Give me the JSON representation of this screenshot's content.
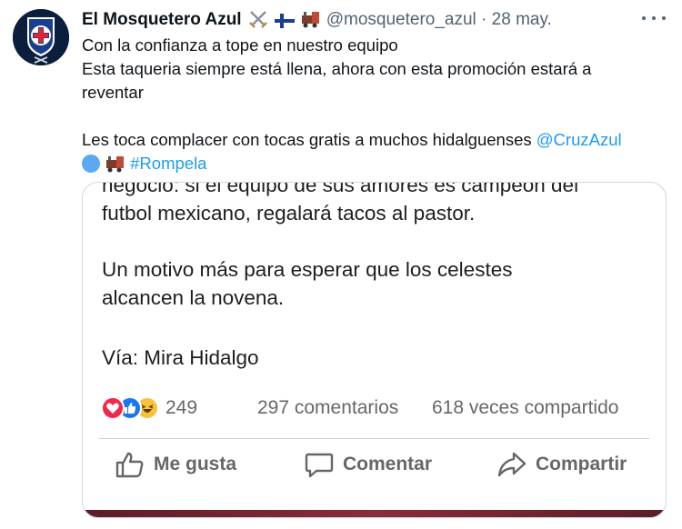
{
  "tweet": {
    "display_name": "El Mosquetero Azul",
    "name_emojis": [
      "crossed-swords-emoji",
      "finland-flag-emoji",
      "train-emoji"
    ],
    "handle": "@mosquetero_azul",
    "separator": "·",
    "date": "28 may.",
    "more_icon": "more-options-icon",
    "text_lines": [
      "Con la confianza a tope en nuestro equipo",
      "Esta taqueria siempre está llena, ahora con esta promoción estará a",
      "reventar",
      "Les toca complacer con tocas gratis a muchos hidalguenses "
    ],
    "mention": "@CruzAzul",
    "hashtag": "#Rompela",
    "tag_emojis": [
      "blue-circle-emoji",
      "train-emoji"
    ],
    "link_color": "#1d9bf0"
  },
  "avatar": {
    "badge_top_text": "DEPORTIVO",
    "badge_bottom_text": "CRUZ AZUL"
  },
  "embedded_post": {
    "clipped_line": "negocio: si el equipo de sus amores es campeón del",
    "lines": [
      "futbol mexicano, regalará tacos al pastor.",
      "Un motivo más para esperar que los celestes",
      "alcancen la novena.",
      "Vía: Mira Hidalgo"
    ],
    "reaction_icons": [
      "love-reaction-icon",
      "like-reaction-icon",
      "haha-reaction-icon"
    ],
    "reaction_count": "249",
    "comments": "297 comentarios",
    "shares": "618 veces compartido",
    "actions": {
      "like": "Me gusta",
      "comment": "Comentar",
      "share": "Compartir"
    }
  }
}
